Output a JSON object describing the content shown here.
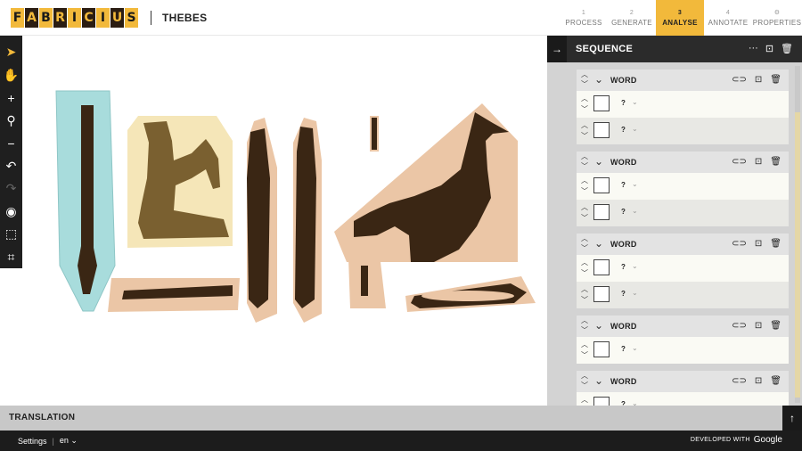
{
  "header": {
    "logo_letters": [
      "F",
      "A",
      "B",
      "R",
      "I",
      "C",
      "I",
      "U",
      "S"
    ],
    "project_name": "THEBES",
    "steps": [
      {
        "num": "1",
        "label": "PROCESS",
        "active": false
      },
      {
        "num": "2",
        "label": "GENERATE",
        "active": false
      },
      {
        "num": "3",
        "label": "ANALYSE",
        "active": true
      },
      {
        "num": "4",
        "label": "ANNOTATE",
        "active": false
      },
      {
        "num": "⚙",
        "label": "PROPERTIES",
        "active": false
      }
    ]
  },
  "toolbar": {
    "tools": [
      {
        "name": "select-icon",
        "glyph": "➤",
        "state": "active"
      },
      {
        "name": "pan-hand-icon",
        "glyph": "✋",
        "state": "normal"
      },
      {
        "name": "zoom-in-icon",
        "glyph": "+",
        "state": "normal"
      },
      {
        "name": "search-icon",
        "glyph": "⚲",
        "state": "normal"
      },
      {
        "name": "zoom-out-icon",
        "glyph": "−",
        "state": "normal"
      },
      {
        "name": "undo-icon",
        "glyph": "↶",
        "state": "normal"
      },
      {
        "name": "redo-icon",
        "glyph": "↷",
        "state": "disabled"
      },
      {
        "name": "fill-drop-icon",
        "glyph": "◉",
        "state": "normal"
      },
      {
        "name": "bounding-box-icon",
        "glyph": "⬚",
        "state": "normal"
      },
      {
        "name": "merge-nodes-icon",
        "glyph": "⌗",
        "state": "normal"
      }
    ]
  },
  "panel": {
    "title": "SEQUENCE",
    "more_glyph": "···",
    "words": [
      {
        "label": "WORD",
        "signs": [
          "?",
          "?"
        ]
      },
      {
        "label": "WORD",
        "signs": [
          "?",
          "?"
        ]
      },
      {
        "label": "WORD",
        "signs": [
          "?",
          "?"
        ]
      },
      {
        "label": "WORD",
        "signs": [
          "?"
        ]
      },
      {
        "label": "WORD",
        "signs": [
          "?"
        ]
      }
    ]
  },
  "translation": {
    "label": "TRANSLATION"
  },
  "footer": {
    "settings": "Settings",
    "separator": "|",
    "language": "en",
    "developed_with": "DEVELOPED WITH",
    "brand": "Google"
  },
  "colors": {
    "accent": "#f2b93b",
    "dark": "#2b1d12",
    "glyph_fill": "#3a2614",
    "region_peach": "#ebc6a6",
    "region_cream": "#f5e6b8",
    "region_teal": "#a8dcdc"
  }
}
